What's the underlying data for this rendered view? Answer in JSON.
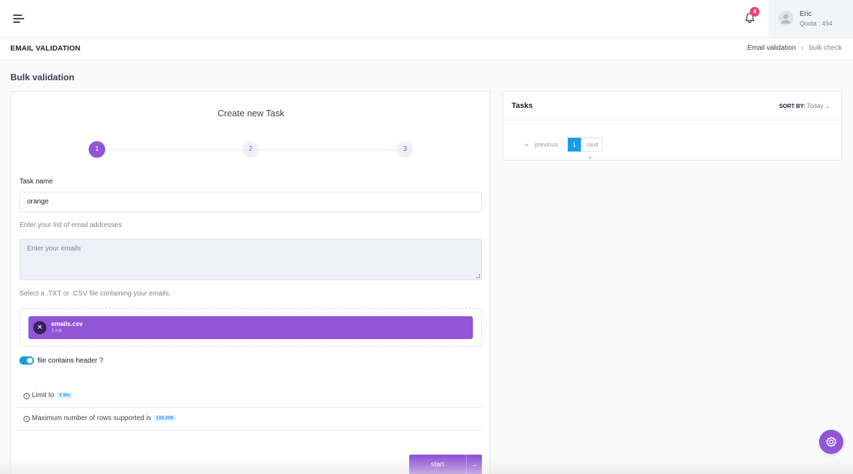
{
  "header": {
    "notification_count": "4",
    "user": {
      "name": "Eric",
      "quota": "Quota : 494"
    }
  },
  "subheader": {
    "title": "EMAIL VALIDATION",
    "breadcrumb": [
      "Email validation",
      "bulk check"
    ]
  },
  "section_title": "Bulk validation",
  "create_task": {
    "title": "Create new Task",
    "steps": [
      "1",
      "2",
      "3"
    ],
    "active_step": 1,
    "task_name_label": "Task name",
    "task_name_value": "orange",
    "emails_label": "Enter your list of email addresses",
    "emails_placeholder": "Enter your emails",
    "file_label": "Select a .TXT or .CSV file containing your emails.",
    "file": {
      "name": "emails.csv",
      "size": "3 KB"
    },
    "header_toggle_label": "file contains header ?",
    "header_toggle_on": true,
    "limit_text": "Limit to",
    "limit_chip": "3 Mo",
    "max_rows_text": "Maximum number of rows supported is",
    "max_rows_chip": "100,000",
    "start_label": "start"
  },
  "tasks": {
    "title": "Tasks",
    "sort_by_label": "SORT BY:",
    "sort_by_value": "Today",
    "pagination": {
      "previous": "previous",
      "current": "1",
      "next": "next"
    }
  },
  "icons": [
    "menu-icon",
    "bell-icon",
    "user-avatar-icon",
    "close-icon",
    "info-icon",
    "arrow-right-icon",
    "chevron-down-icon",
    "gear-icon"
  ],
  "colors": {
    "accent": "#9155d7",
    "blue": "#1d9ae6",
    "badge": "#f1416c"
  }
}
